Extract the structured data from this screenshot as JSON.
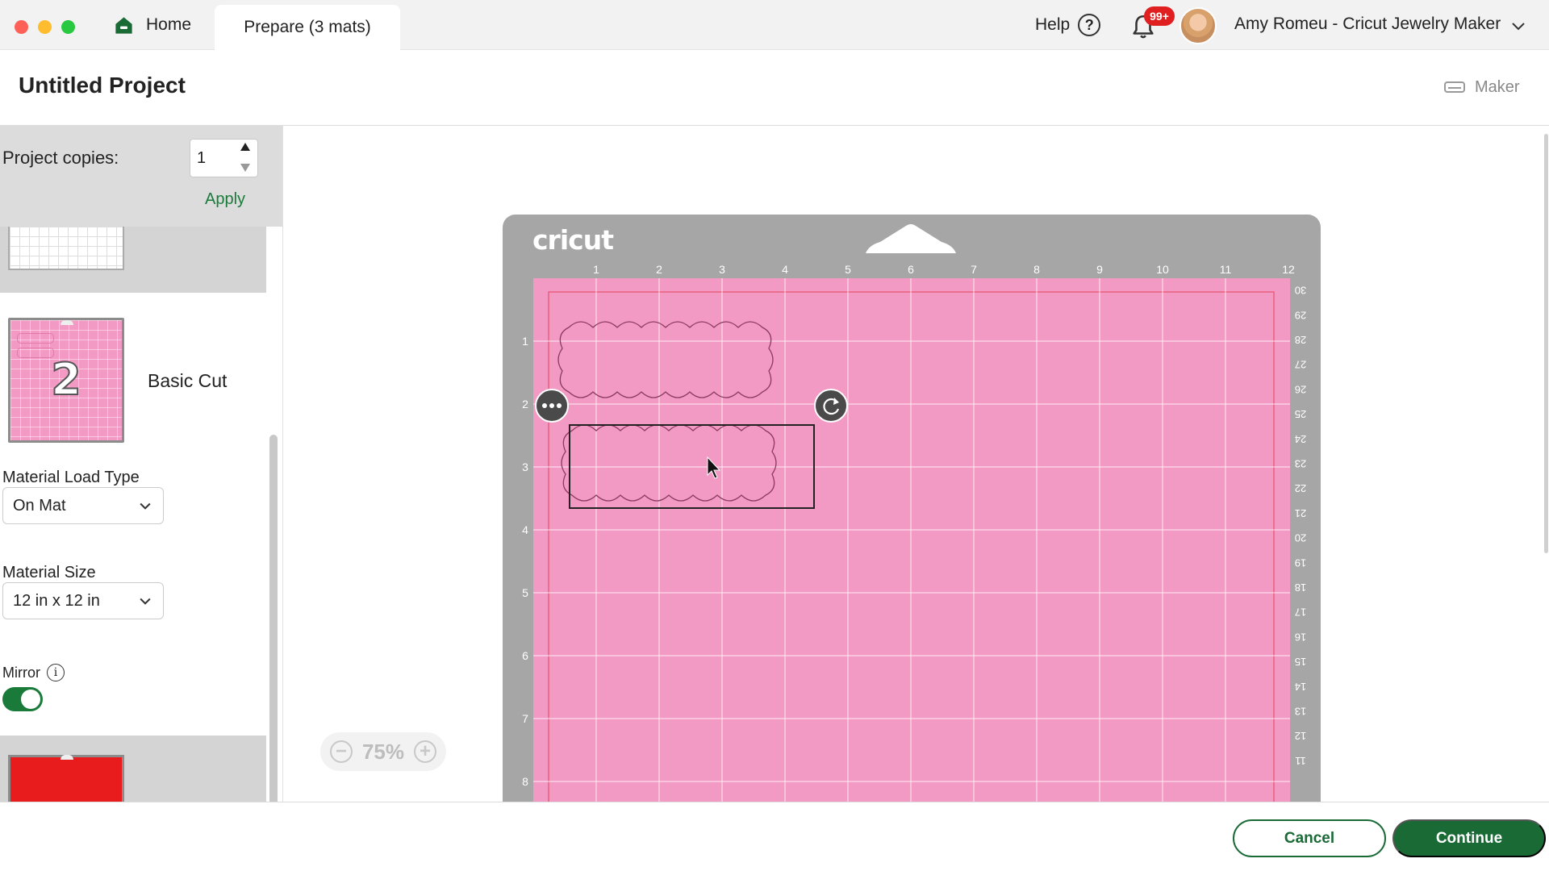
{
  "tabs": {
    "home": "Home",
    "prepare": "Prepare (3 mats)"
  },
  "header": {
    "help": "Help",
    "notifications_badge": "99+",
    "user": "Amy Romeu - Cricut Jewelry Maker"
  },
  "project": {
    "title": "Untitled Project",
    "machine": "Maker"
  },
  "sidebar": {
    "copies_label": "Project copies:",
    "copies_value": "1",
    "apply": "Apply",
    "mat_number": "2",
    "cut_type": "Basic Cut",
    "load_type_label": "Material Load Type",
    "load_type_value": "On Mat",
    "size_label": "Material Size",
    "size_value": "12 in x 12 in",
    "mirror_label": "Mirror",
    "mirror_on": true
  },
  "mat": {
    "brand": "cricut",
    "top_ruler": [
      "1",
      "2",
      "3",
      "4",
      "5",
      "6",
      "7",
      "8",
      "9",
      "10",
      "11",
      "12"
    ],
    "left_ruler": [
      "1",
      "2",
      "3",
      "4",
      "5",
      "6",
      "7",
      "8"
    ],
    "right_ruler": [
      "30",
      "29",
      "28",
      "27",
      "26",
      "25",
      "24",
      "23",
      "22",
      "21",
      "20",
      "19",
      "18",
      "17",
      "16",
      "15",
      "14",
      "13",
      "12",
      "11"
    ],
    "color": "#f39ac4"
  },
  "zoom": {
    "level": "75%"
  },
  "footer": {
    "cancel": "Cancel",
    "continue": "Continue"
  },
  "colors": {
    "accent": "#1a6a36",
    "mat_pink": "#f39ac4",
    "badge": "#e02020"
  }
}
